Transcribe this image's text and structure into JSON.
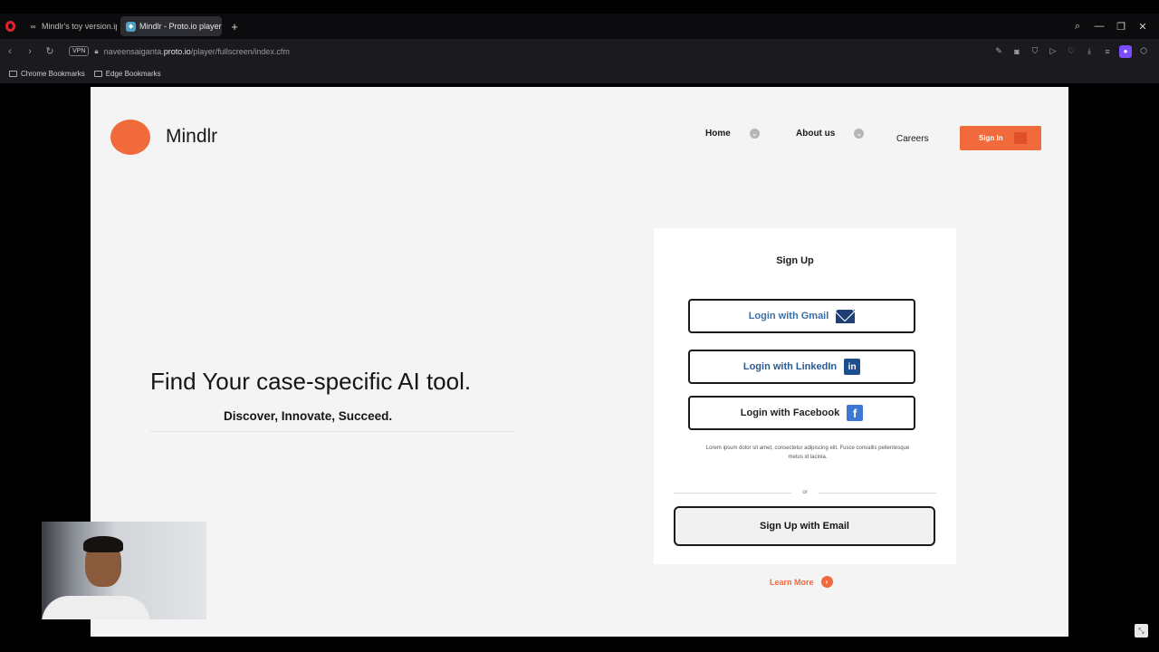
{
  "browser": {
    "tabs": [
      {
        "label": "Mindlr's toy version.ipynb",
        "icon": "infinity-icon"
      },
      {
        "label": "Mindlr - Proto.io player",
        "icon": "protoio-icon"
      }
    ],
    "new_tab_glyph": "+",
    "vpn_label": "VPN",
    "url_prefix": "naveensaiganta.",
    "url_domain": "proto.io",
    "url_path": "/player/fullscreen/index.cfm",
    "bookmarks": [
      {
        "label": "Chrome Bookmarks"
      },
      {
        "label": "Edge Bookmarks"
      }
    ]
  },
  "site": {
    "brand": "Mindlr",
    "nav": {
      "home": "Home",
      "about": "About us",
      "careers": "Careers",
      "signin": "Sign In"
    },
    "hero": {
      "title": "Find Your case-specific AI tool.",
      "subtitle": "Discover, Innovate, Succeed."
    },
    "card": {
      "title": "Sign Up",
      "gmail": "Login with Gmail",
      "linkedin": "Login with LinkedIn",
      "linkedin_icon_text": "in",
      "facebook": "Login with Facebook",
      "facebook_icon_text": "f",
      "lorem": "Lorem ipsum dolor sit amet, consectetur adipiscing elit. Fusce convallis pellentesque metus id lacinia.",
      "or": "or",
      "email_signup": "Sign Up with Email"
    },
    "learn_more": "Learn More"
  },
  "colors": {
    "accent": "#f06a3c",
    "page_bg": "#f4f4f4",
    "card_bg": "#ffffff"
  }
}
